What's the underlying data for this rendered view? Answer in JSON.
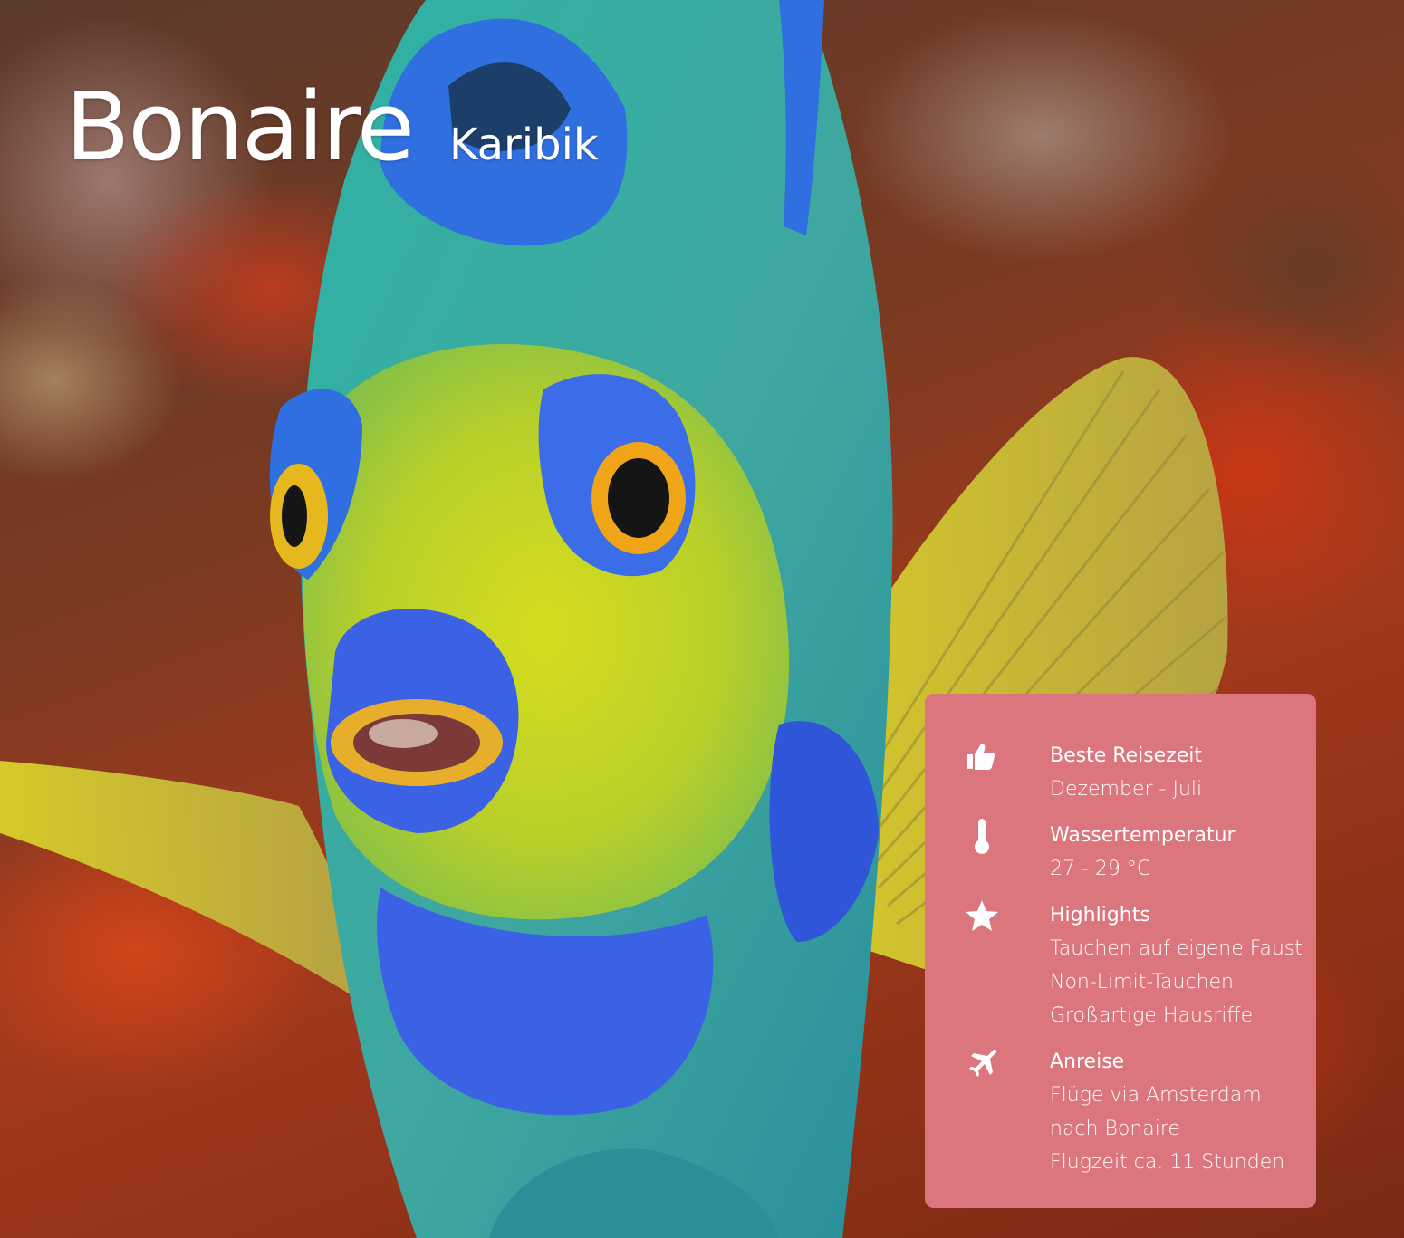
{
  "page": {
    "title": "Bonaire",
    "subtitle": "Karibik"
  },
  "info_card": {
    "background_color": "#db757e",
    "items": [
      {
        "icon": "thumbs-up-icon",
        "label": "Beste Reisezeit",
        "lines": [
          "Dezember - Juli"
        ]
      },
      {
        "icon": "thermometer-icon",
        "label": "Wassertemperatur",
        "lines": [
          "27 - 29 °C"
        ]
      },
      {
        "icon": "star-icon",
        "label": "Highlights",
        "lines": [
          "Tauchen auf eigene Faust",
          "Non-Limit-Tauchen",
          "Großartige Hausriffe"
        ]
      },
      {
        "icon": "airplane-icon",
        "label": "Anreise",
        "lines": [
          "Flüge via Amsterdam",
          "nach Bonaire",
          "Flugzeit ca. 11 Stunden"
        ]
      }
    ]
  }
}
